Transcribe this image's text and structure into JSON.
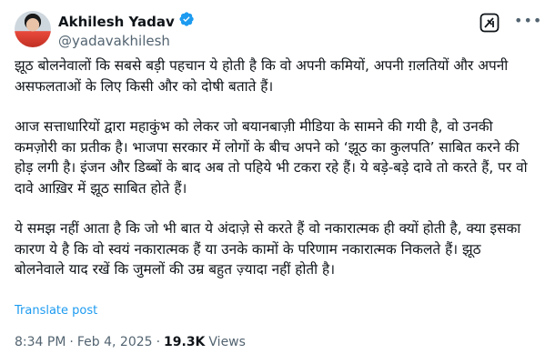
{
  "author": {
    "name": "Akhilesh Yadav",
    "handle": "@yadavakhilesh",
    "verified_color": "#1d9bf0"
  },
  "icons": {
    "grok": "grok-icon",
    "more": "more-icon",
    "verified": "verified-badge-icon"
  },
  "tweet": {
    "paragraphs": [
      "झूठ बोलनेवालों कि सबसे बड़ी पहचान ये होती है कि वो अपनी कमियों, अपनी ग़लतियों और अपनी असफलताओं के लिए किसी और को दोषी बताते हैं।",
      "आज सत्ताधारियों द्वारा महाकुंभ को लेकर जो बयानबाज़ी मीडिया के सामने की गयी है, वो उनकी कमज़ोरी का प्रतीक है। भाजपा सरकार में लोगों के बीच अपने को ‘झूठ का कुलपति’ साबित करने की होड़ लगी है। इंजन और डिब्बों के बाद अब तो पहिये भी टकरा रहे हैं। ये बड़े-बड़े दावे तो करते हैं, पर वो दावे आख़िर में झूठ साबित होते हैं।",
      "ये समझ नहीं आता है कि जो भी बात ये अंदाज़े से करते हैं वो नकारात्मक ही क्यों होती है, क्या इसका कारण ये है कि वो स्वयं नकारात्मक हैं या उनके कामों के परिणाम नकारात्मक निकलते हैं। झूठ बोलनेवाले याद रखें कि जुमलों की उम्र बहुत ज़्यादा नहीं होती है।"
    ],
    "translate_label": "Translate post"
  },
  "meta": {
    "time": "8:34 PM",
    "separator": "·",
    "date": "Feb 4, 2025",
    "separator2": "·",
    "views_count": "19.3K",
    "views_label": "Views"
  }
}
